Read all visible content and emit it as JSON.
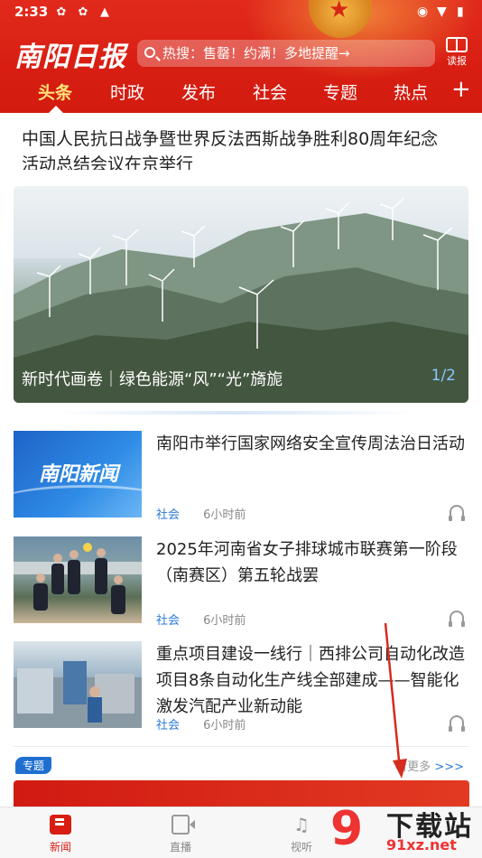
{
  "status_bar": {
    "time": "2:33"
  },
  "app": {
    "logo": "南阳日报",
    "search_placeholder": "热搜：售罄！约满！多地提醒→",
    "reader_label": "读报"
  },
  "tabs": [
    "头条",
    "时政",
    "发布",
    "社会",
    "专题",
    "热点"
  ],
  "headline": "中国人民抗日战争暨世界反法西斯战争胜利80周年纪念活动总结会议在京举行",
  "banner": {
    "caption": "新时代画卷｜绿色能源“风”“光”旖旎",
    "pager": "1/2"
  },
  "news": [
    {
      "thumb_text": "南阳新闻",
      "title": "南阳市举行国家网络安全宣传周法治日活动",
      "category": "社会",
      "time": "6小时前"
    },
    {
      "title": "2025年河南省女子排球城市联赛第一阶段（南赛区）第五轮战罢",
      "category": "社会",
      "time": "6小时前"
    },
    {
      "title": "重点项目建设一线行｜西排公司自动化改造项目8条自动化生产线全部建成——智能化激发汽配产业新动能",
      "category": "社会",
      "time": "6小时前"
    }
  ],
  "special": {
    "badge": "专题",
    "more": "看更多",
    "more_arrow": ">>>"
  },
  "bottom_nav": [
    "新闻",
    "直播",
    "视听"
  ],
  "watermark": {
    "nine": "9",
    "text": "下载站",
    "url": "91xz.net"
  },
  "colors": {
    "brand_red": "#d81e12",
    "accent_yellow": "#ffe27a",
    "link_blue": "#2a7ad6"
  }
}
